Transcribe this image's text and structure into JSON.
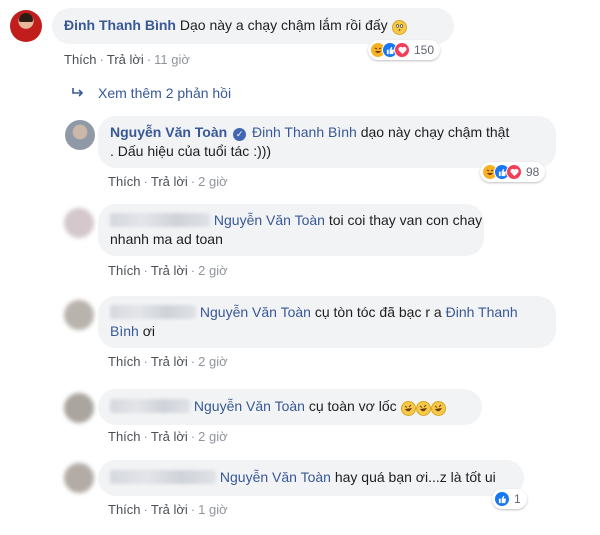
{
  "comment_main": {
    "author": "Đinh Thanh Bình",
    "text": "Dạo này a chạy chậm lắm rồi đấy",
    "like_label": "Thích",
    "reply_label": "Trả lời",
    "time": "11 giờ",
    "reaction_count": "150",
    "reactions": [
      "haha-icon",
      "like-icon",
      "love-icon"
    ]
  },
  "view_more_replies": "Xem thêm 2 phản hồi",
  "reply_1": {
    "author": "Nguyễn Văn Toàn",
    "tag": "Đinh Thanh Bình",
    "text_1": "dạo này chạy chậm thật",
    "text_2": ". Dấu hiệu của tuổi tác :)))",
    "like_label": "Thích",
    "reply_label": "Trả lời",
    "time": "2 giờ",
    "reaction_count": "98",
    "reactions": [
      "haha-icon",
      "like-icon",
      "love-icon"
    ]
  },
  "reply_2": {
    "tag": "Nguyễn Văn Toàn",
    "text_1": "toi coi thay van con chay",
    "text_2": "nhanh ma ad toan",
    "like_label": "Thích",
    "reply_label": "Trả lời",
    "time": "2 giờ"
  },
  "reply_3": {
    "tag": "Nguyễn Văn Toàn",
    "text_1": "cụ tòn tóc đã bạc r a",
    "tag_2a": "Đinh Thanh",
    "tag_2b": "Bình",
    "text_2": "ơi",
    "like_label": "Thích",
    "reply_label": "Trả lời",
    "time": "2 giờ"
  },
  "reply_4": {
    "tag": "Nguyễn Văn Toàn",
    "text": "cụ toàn vơ lốc",
    "like_label": "Thích",
    "reply_label": "Trả lời",
    "time": "2 giờ"
  },
  "reply_5": {
    "tag": "Nguyễn Văn Toàn",
    "text": "hay quá bạn ơi...z là tốt ui",
    "like_label": "Thích",
    "reply_label": "Trả lời",
    "time": "1 giờ",
    "reaction_count": "1",
    "reactions": [
      "like-icon"
    ]
  },
  "colors": {
    "link": "#385898",
    "bubble": "#f2f3f5",
    "muted": "#90949c",
    "like": "#1877f2",
    "love": "#f33e58",
    "haha": "#f7b125"
  }
}
